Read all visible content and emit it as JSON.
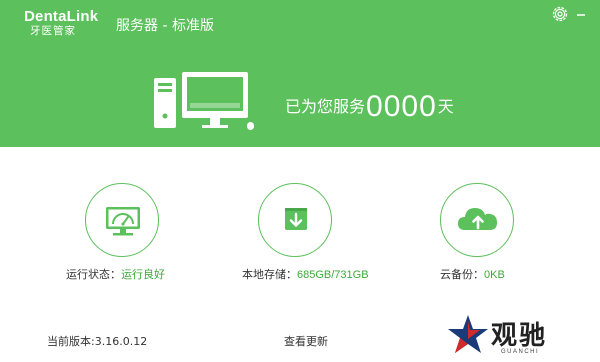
{
  "app": {
    "logo_brand": "DentaLink",
    "logo_subtitle": "牙医管家",
    "title": "服务器 - 标准版"
  },
  "service": {
    "prefix": "已为您服务",
    "days": "0000",
    "unit": "天"
  },
  "stats": {
    "run_status_label": "运行状态：",
    "run_status_value": "运行良好",
    "local_storage_label": "本地存储：",
    "local_storage_value": "685GB/731GB",
    "cloud_backup_label": "云备份：",
    "cloud_backup_value": "0KB"
  },
  "footer": {
    "version_label": "当前版本:3.16.0.12",
    "check_update": "查看更新"
  },
  "watermark": {
    "text": "观驰",
    "subtext": "GUANCHI"
  },
  "colors": {
    "header_green": "#5cc05c",
    "value_green": "#3aaa3a"
  },
  "icons": [
    "gear-icon",
    "minimize-icon",
    "computer-icon",
    "gauge-monitor-icon",
    "download-icon",
    "cloud-upload-icon"
  ]
}
